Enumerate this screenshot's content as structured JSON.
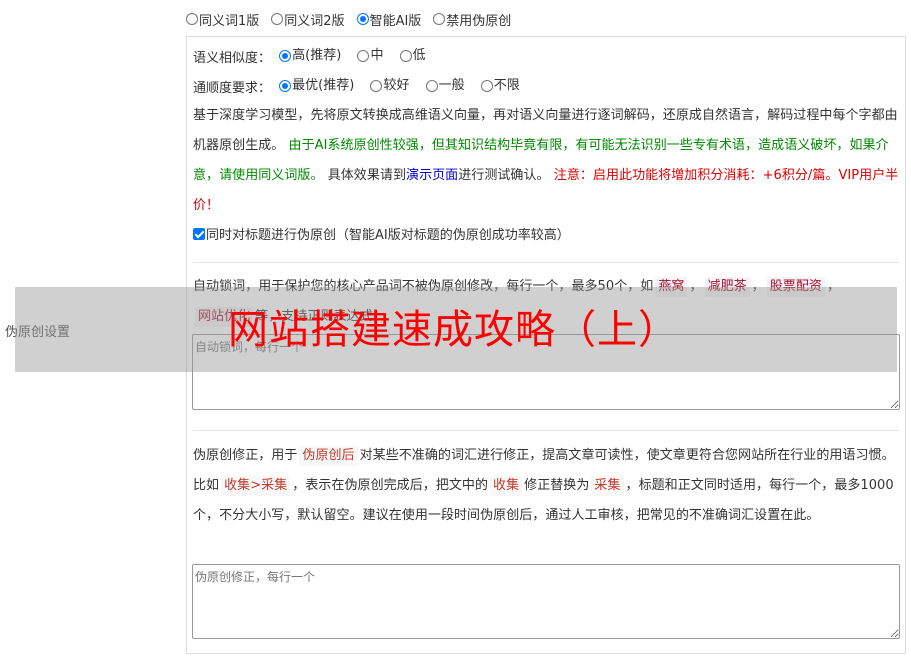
{
  "section_label": "伪原创设置",
  "version_options": [
    {
      "label": "同义词1版",
      "selected": false
    },
    {
      "label": "同义词2版",
      "selected": false
    },
    {
      "label": "智能AI版",
      "selected": true
    },
    {
      "label": "禁用伪原创",
      "selected": false
    }
  ],
  "similarity": {
    "label": "语义相似度：",
    "options": [
      {
        "label": "高(推荐)",
        "selected": true
      },
      {
        "label": "中",
        "selected": false
      },
      {
        "label": "低",
        "selected": false
      }
    ]
  },
  "fluency": {
    "label": "通顺度要求：",
    "options": [
      {
        "label": "最优(推荐)",
        "selected": true
      },
      {
        "label": "较好",
        "selected": false
      },
      {
        "label": "一般",
        "selected": false
      },
      {
        "label": "不限",
        "selected": false
      }
    ]
  },
  "description": {
    "intro": "基于深度学习模型，先将原文转换成高维语义向量，再对语义向量进行逐词解码，还原成自然语言，解码过程中每个字都由机器原创生成。",
    "warning_green": "由于AI系统原创性较强，但其知识结构毕竟有限，有可能无法识别一些专有术语，造成语义破坏，如果介意，请使用同义词版。",
    "effect_prefix": "具体效果请到",
    "demo_link": "演示页面",
    "effect_suffix": "进行测试确认。",
    "cost_notice": "注意：启用此功能将增加积分消耗：+6积分/篇。VIP用户半价！"
  },
  "title_checkbox": {
    "checked": true,
    "label": "同时对标题进行伪原创（智能AI版对标题的伪原创成功率较高）"
  },
  "lock_words": {
    "desc_prefix": "自动锁词，用于保护您的核心产品词不被伪原创修改，每行一个，最多50个，如",
    "examples": [
      "燕窝",
      "减肥茶",
      "股票配资",
      "网站优化"
    ],
    "desc_suffix": "等，支持正则表达式。",
    "placeholder": "自动锁词，每行一个"
  },
  "correction": {
    "line1_prefix": "伪原创修正，用于",
    "tag_pseudo": "伪原创后",
    "line1_suffix": "对某些不准确的词汇进行修正，提高文章可读性，使文章更符合您网站所在行业的用语习惯。比如",
    "tag_example": "收集>采集",
    "mid1": "，表示在伪原创完成后，把文中的",
    "tag_from": "收集",
    "mid2": "修正替换为",
    "tag_to": "采集",
    "tail": "，标题和正文同时适用，每行一个，最多1000个，不分大小写，默认留空。建议在使用一段时间伪原创后，通过人工审核，把常见的不准确词汇设置在此。",
    "placeholder": "伪原创修正，每行一个"
  },
  "overlay_title": "网站搭建速成攻略（上）",
  "colors": {
    "accent": "#0075ff",
    "green_text": "#008800",
    "link": "#0000cc",
    "warning": "#dd0000",
    "overlay_text": "#ff0000"
  }
}
